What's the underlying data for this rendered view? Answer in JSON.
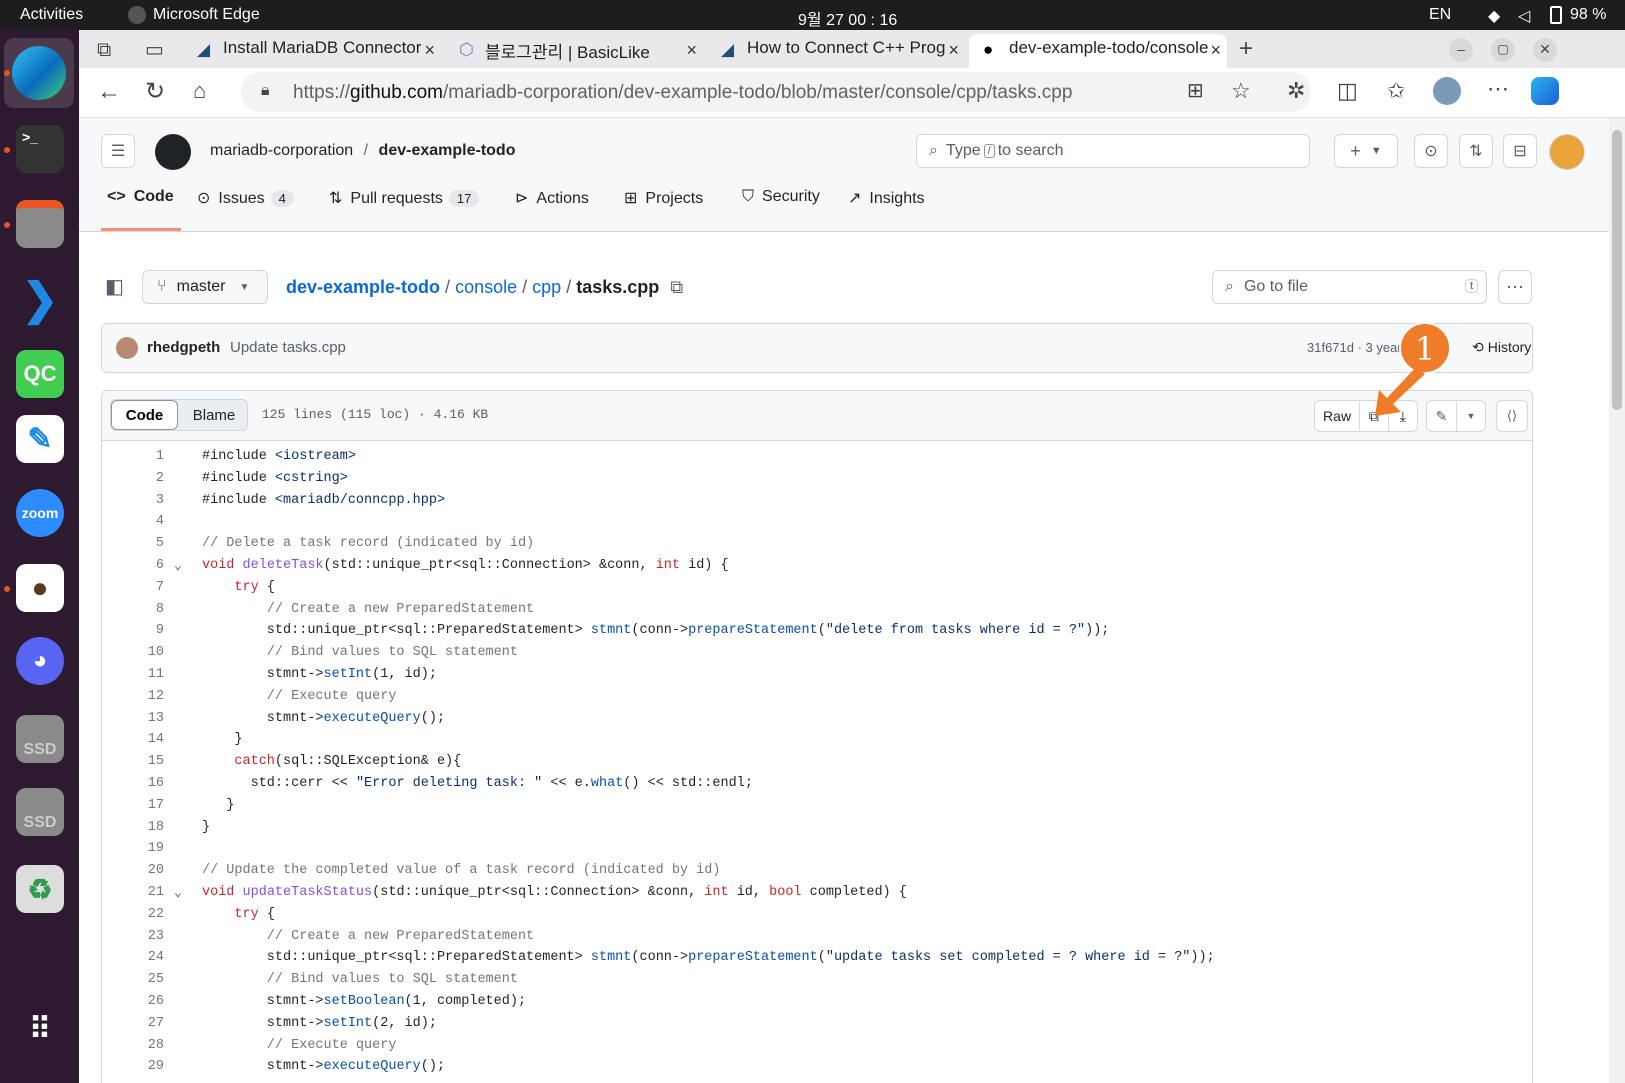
{
  "system_bar": {
    "activities": "Activities",
    "app": "Microsoft Edge",
    "clock": "9월 27  00 : 16",
    "lang": "EN",
    "battery": "98 %"
  },
  "dock": {
    "items": [
      "edge-icon",
      "terminal-icon",
      "files-icon",
      "vscode-icon",
      "qtcreator-icon",
      "text-editor-icon",
      "zoom-icon",
      "dbeaver-icon",
      "discord-icon",
      "ssd-drive-icon",
      "ssd-drive-icon",
      "trash-icon",
      "app-grid-icon"
    ],
    "labels": {
      "qc": "QC",
      "zoom": "zoom",
      "ssd1": "SSD",
      "ssd2": "SSD"
    }
  },
  "browser": {
    "tabs": [
      {
        "title": "Install MariaDB Connector"
      },
      {
        "title": "블로그관리 | BasicLike"
      },
      {
        "title": "How to Connect C++ Prog"
      },
      {
        "title": "dev-example-todo/console",
        "active": true
      }
    ],
    "close_glyph": "×",
    "url_prefix": "https://",
    "url_host": "github.com",
    "url_path": "/mariadb-corporation/dev-example-todo/blob/master/console/cpp/tasks.cpp"
  },
  "github": {
    "owner": "mariadb-corporation",
    "sep": "/",
    "repo": "dev-example-todo",
    "search_prefix": "Type",
    "search_key": "/",
    "search_suffix": "to search",
    "tabs": [
      {
        "label": "Code",
        "count": ""
      },
      {
        "label": "Issues",
        "count": "4"
      },
      {
        "label": "Pull requests",
        "count": "17"
      },
      {
        "label": "Actions",
        "count": ""
      },
      {
        "label": "Projects",
        "count": ""
      },
      {
        "label": "Security",
        "count": ""
      },
      {
        "label": "Insights",
        "count": ""
      }
    ],
    "branch": "master",
    "breadcrumb": {
      "repo": "dev-example-todo",
      "dir1": "console",
      "dir2": "cpp",
      "file": "tasks.cpp",
      "sep": "/"
    },
    "go_to_file": "Go to file",
    "go_to_file_key": "t",
    "commit": {
      "author": "rhedgpeth",
      "message": "Update tasks.cpp",
      "meta": "31f671d · 3 years a",
      "history": "History"
    },
    "file_header": {
      "code_tab": "Code",
      "blame_tab": "Blame",
      "info": "125 lines (115 loc) · 4.16 KB",
      "raw": "Raw"
    },
    "annotation": {
      "number": "1",
      "color": "#f07b28"
    }
  },
  "code_lines": [
    "1",
    "2",
    "3",
    "4",
    "5",
    "6",
    "7",
    "8",
    "9",
    "10",
    "11",
    "12",
    "13",
    "14",
    "15",
    "16",
    "17",
    "18",
    "19",
    "20",
    "21",
    "22",
    "23",
    "24",
    "25",
    "26",
    "27",
    "28",
    "29"
  ],
  "code_text": [
    {
      "p": [
        {
          "k": "",
          "t": "#include "
        },
        {
          "k": "s",
          "t": "<iostream>"
        }
      ]
    },
    {
      "p": [
        {
          "k": "",
          "t": "#include "
        },
        {
          "k": "s",
          "t": "<cstring>"
        }
      ]
    },
    {
      "p": [
        {
          "k": "",
          "t": "#include "
        },
        {
          "k": "s",
          "t": "<mariadb/conncpp.hpp>"
        }
      ]
    },
    {
      "p": []
    },
    {
      "p": [
        {
          "k": "c",
          "t": "// Delete a task record (indicated by id)"
        }
      ]
    },
    {
      "p": [
        {
          "k": "k",
          "t": "void "
        },
        {
          "k": "f",
          "t": "deleteTask"
        },
        {
          "k": "",
          "t": "(std::unique_ptr<sql::Connection> &conn, "
        },
        {
          "k": "k",
          "t": "int"
        },
        {
          "k": "",
          "t": " id) {"
        }
      ]
    },
    {
      "p": [
        {
          "k": "",
          "t": "    "
        },
        {
          "k": "k",
          "t": "try"
        },
        {
          "k": "",
          "t": " {"
        }
      ]
    },
    {
      "p": [
        {
          "k": "c",
          "t": "        // Create a new PreparedStatement"
        }
      ]
    },
    {
      "p": [
        {
          "k": "",
          "t": "        std::unique_ptr<sql::PreparedStatement> "
        },
        {
          "k": "n",
          "t": "stmnt"
        },
        {
          "k": "",
          "t": "(conn->"
        },
        {
          "k": "n",
          "t": "prepareStatement"
        },
        {
          "k": "",
          "t": "("
        },
        {
          "k": "s",
          "t": "\"delete from tasks where id = ?\""
        },
        {
          "k": "",
          "t": "));"
        }
      ]
    },
    {
      "p": [
        {
          "k": "c",
          "t": "        // Bind values to SQL statement"
        }
      ]
    },
    {
      "p": [
        {
          "k": "",
          "t": "        stmnt->"
        },
        {
          "k": "n",
          "t": "setInt"
        },
        {
          "k": "",
          "t": "(1, id);"
        }
      ]
    },
    {
      "p": [
        {
          "k": "c",
          "t": "        // Execute query"
        }
      ]
    },
    {
      "p": [
        {
          "k": "",
          "t": "        stmnt->"
        },
        {
          "k": "n",
          "t": "executeQuery"
        },
        {
          "k": "",
          "t": "();"
        }
      ]
    },
    {
      "p": [
        {
          "k": "",
          "t": "    }"
        }
      ]
    },
    {
      "p": [
        {
          "k": "",
          "t": "    "
        },
        {
          "k": "k",
          "t": "catch"
        },
        {
          "k": "",
          "t": "(sql::SQLException& e){"
        }
      ]
    },
    {
      "p": [
        {
          "k": "",
          "t": "      std::cerr << "
        },
        {
          "k": "s",
          "t": "\"Error deleting task: \""
        },
        {
          "k": "",
          "t": " << e."
        },
        {
          "k": "n",
          "t": "what"
        },
        {
          "k": "",
          "t": "() << std::endl;"
        }
      ]
    },
    {
      "p": [
        {
          "k": "",
          "t": "   }"
        }
      ]
    },
    {
      "p": [
        {
          "k": "",
          "t": "}"
        }
      ]
    },
    {
      "p": []
    },
    {
      "p": [
        {
          "k": "c",
          "t": "// Update the completed value of a task record (indicated by id)"
        }
      ]
    },
    {
      "p": [
        {
          "k": "k",
          "t": "void "
        },
        {
          "k": "f",
          "t": "updateTaskStatus"
        },
        {
          "k": "",
          "t": "(std::unique_ptr<sql::Connection> &conn, "
        },
        {
          "k": "k",
          "t": "int"
        },
        {
          "k": "",
          "t": " id, "
        },
        {
          "k": "k",
          "t": "bool"
        },
        {
          "k": "",
          "t": " completed) {"
        }
      ]
    },
    {
      "p": [
        {
          "k": "",
          "t": "    "
        },
        {
          "k": "k",
          "t": "try"
        },
        {
          "k": "",
          "t": " {"
        }
      ]
    },
    {
      "p": [
        {
          "k": "c",
          "t": "        // Create a new PreparedStatement"
        }
      ]
    },
    {
      "p": [
        {
          "k": "",
          "t": "        std::unique_ptr<sql::PreparedStatement> "
        },
        {
          "k": "n",
          "t": "stmnt"
        },
        {
          "k": "",
          "t": "(conn->"
        },
        {
          "k": "n",
          "t": "prepareStatement"
        },
        {
          "k": "",
          "t": "("
        },
        {
          "k": "s",
          "t": "\"update tasks set completed = ? where id = ?\""
        },
        {
          "k": "",
          "t": "));"
        }
      ]
    },
    {
      "p": [
        {
          "k": "c",
          "t": "        // Bind values to SQL statement"
        }
      ]
    },
    {
      "p": [
        {
          "k": "",
          "t": "        stmnt->"
        },
        {
          "k": "n",
          "t": "setBoolean"
        },
        {
          "k": "",
          "t": "(1, completed);"
        }
      ]
    },
    {
      "p": [
        {
          "k": "",
          "t": "        stmnt->"
        },
        {
          "k": "n",
          "t": "setInt"
        },
        {
          "k": "",
          "t": "(2, id);"
        }
      ]
    },
    {
      "p": [
        {
          "k": "c",
          "t": "        // Execute query"
        }
      ]
    },
    {
      "p": [
        {
          "k": "",
          "t": "        stmnt->"
        },
        {
          "k": "n",
          "t": "executeQuery"
        },
        {
          "k": "",
          "t": "();"
        }
      ]
    }
  ],
  "folds": {
    "6": "⌄",
    "21": "⌄"
  }
}
